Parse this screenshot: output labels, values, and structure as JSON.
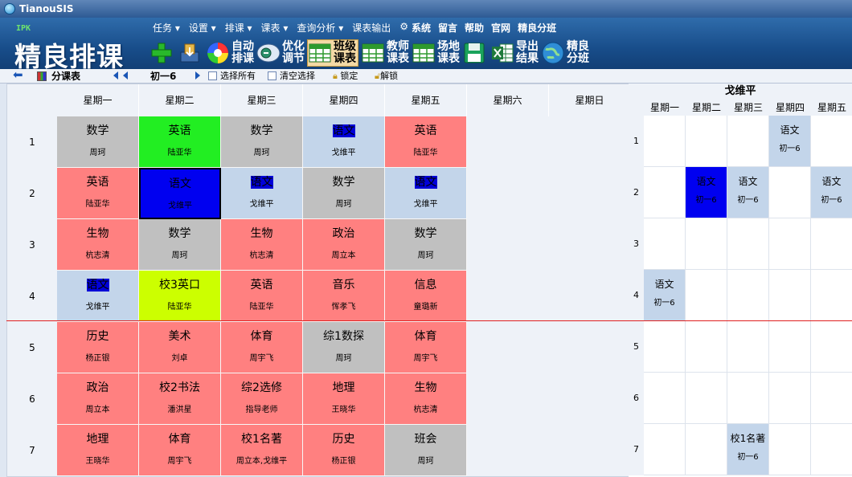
{
  "window": {
    "title": "TianouSIS"
  },
  "logo": {
    "sub": "IPK",
    "title": "精良排课"
  },
  "menus": [
    "任务 ▾",
    "设置 ▾",
    "排课 ▾",
    "课表 ▾",
    "查询分析 ▾",
    "课表输出"
  ],
  "menus_bold": [
    "系统",
    "留言",
    "帮助",
    "官网",
    "精良分班"
  ],
  "tools": [
    {
      "icon": "add-icon",
      "l1": "",
      "l2": ""
    },
    {
      "icon": "import-icon",
      "l1": "",
      "l2": ""
    },
    {
      "icon": "color-wheel-icon",
      "l1": "自动",
      "l2": "排课"
    },
    {
      "icon": "tune-icon",
      "l1": "优化",
      "l2": "调节"
    },
    {
      "icon": "table-icon",
      "l1": "班级",
      "l2": "课表",
      "active": true
    },
    {
      "icon": "table-icon",
      "l1": "教师",
      "l2": "课表"
    },
    {
      "icon": "table-icon",
      "l1": "场地",
      "l2": "课表"
    },
    {
      "icon": "save-icon",
      "l1": "",
      "l2": ""
    },
    {
      "icon": "excel-icon",
      "l1": "导出",
      "l2": "结果"
    },
    {
      "icon": "globe-icon",
      "l1": "精良",
      "l2": "分班"
    }
  ],
  "toolbar2": {
    "view": "分课表",
    "class_name": "初一6",
    "select_all": "选择所有",
    "clear_select": "清空选择",
    "lock": "锁定",
    "unlock": "解锁"
  },
  "days": [
    "星期一",
    "星期二",
    "星期三",
    "星期四",
    "星期五",
    "星期六",
    "星期日"
  ],
  "periods": [
    "1",
    "2",
    "3",
    "4",
    "5",
    "6",
    "7"
  ],
  "colors": {
    "red": "#ff8080",
    "gray": "#c0c0c0",
    "light_blue": "#c3d5ea",
    "green": "#22ee22",
    "blue": "#0000f0",
    "lime": "#ccff00"
  },
  "schedule": [
    [
      {
        "s": "数学",
        "t": "周珂",
        "c": "gray"
      },
      {
        "s": "英语",
        "t": "陆亚华",
        "c": "green"
      },
      {
        "s": "数学",
        "t": "周珂",
        "c": "gray"
      },
      {
        "s": "语文",
        "t": "戈维平",
        "c": "light_blue",
        "hl": true
      },
      {
        "s": "英语",
        "t": "陆亚华",
        "c": "red"
      }
    ],
    [
      {
        "s": "英语",
        "t": "陆亚华",
        "c": "red"
      },
      {
        "s": "语文",
        "t": "戈维平",
        "c": "blue",
        "sel": true
      },
      {
        "s": "语文",
        "t": "戈维平",
        "c": "light_blue",
        "hl": true
      },
      {
        "s": "数学",
        "t": "周珂",
        "c": "gray"
      },
      {
        "s": "语文",
        "t": "戈维平",
        "c": "light_blue",
        "hl": true
      }
    ],
    [
      {
        "s": "生物",
        "t": "杭志清",
        "c": "red"
      },
      {
        "s": "数学",
        "t": "周珂",
        "c": "gray"
      },
      {
        "s": "生物",
        "t": "杭志清",
        "c": "red"
      },
      {
        "s": "政治",
        "t": "周立本",
        "c": "red"
      },
      {
        "s": "数学",
        "t": "周珂",
        "c": "gray"
      }
    ],
    [
      {
        "s": "语文",
        "t": "戈维平",
        "c": "light_blue",
        "hl": true
      },
      {
        "s": "校3英口",
        "t": "陆亚华",
        "c": "lime"
      },
      {
        "s": "英语",
        "t": "陆亚华",
        "c": "red"
      },
      {
        "s": "音乐",
        "t": "恽孝飞",
        "c": "red"
      },
      {
        "s": "信息",
        "t": "童璐新",
        "c": "red"
      }
    ],
    [
      {
        "s": "历史",
        "t": "杨正银",
        "c": "red"
      },
      {
        "s": "美术",
        "t": "刘卓",
        "c": "red"
      },
      {
        "s": "体育",
        "t": "周宇飞",
        "c": "red"
      },
      {
        "s": "综1数探",
        "t": "周珂",
        "c": "gray"
      },
      {
        "s": "体育",
        "t": "周宇飞",
        "c": "red"
      }
    ],
    [
      {
        "s": "政治",
        "t": "周立本",
        "c": "red"
      },
      {
        "s": "校2书法",
        "t": "潘洪星",
        "c": "red"
      },
      {
        "s": "综2选修",
        "t": "指导老师",
        "c": "red"
      },
      {
        "s": "地理",
        "t": "王晓华",
        "c": "red"
      },
      {
        "s": "生物",
        "t": "杭志清",
        "c": "red"
      }
    ],
    [
      {
        "s": "地理",
        "t": "王晓华",
        "c": "red"
      },
      {
        "s": "体育",
        "t": "周宇飞",
        "c": "red"
      },
      {
        "s": "校1名著",
        "t": "周立本,戈维平",
        "c": "red"
      },
      {
        "s": "历史",
        "t": "杨正银",
        "c": "red"
      },
      {
        "s": "班会",
        "t": "周珂",
        "c": "gray"
      }
    ]
  ],
  "teacher_panel": {
    "name": "戈维平",
    "days": [
      "星期一",
      "星期二",
      "星期三",
      "星期四",
      "星期五"
    ],
    "slots": [
      {
        "p": 0,
        "d": 3,
        "s": "语文",
        "t": "初一6",
        "c": "light_blue"
      },
      {
        "p": 1,
        "d": 1,
        "s": "语文",
        "t": "初一6",
        "c": "blue"
      },
      {
        "p": 1,
        "d": 2,
        "s": "语文",
        "t": "初一6",
        "c": "light_blue"
      },
      {
        "p": 1,
        "d": 4,
        "s": "语文",
        "t": "初一6",
        "c": "light_blue"
      },
      {
        "p": 3,
        "d": 0,
        "s": "语文",
        "t": "初一6",
        "c": "light_blue"
      },
      {
        "p": 6,
        "d": 2,
        "s": "校1名著",
        "t": "初一6",
        "c": "light_blue"
      }
    ]
  }
}
